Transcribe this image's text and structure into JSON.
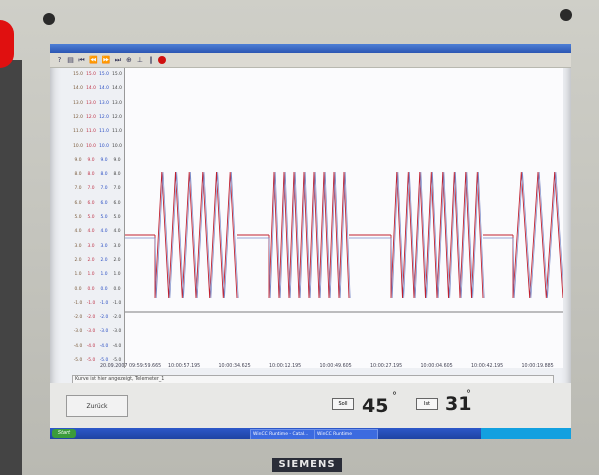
{
  "scales": {
    "columns": [
      {
        "color": "#7a5a3a",
        "values": [
          "15.0",
          "14.0",
          "13.0",
          "12.0",
          "11.0",
          "10.0",
          "9.0",
          "8.0",
          "7.0",
          "6.0",
          "5.0",
          "4.0",
          "3.0",
          "2.0",
          "1.0",
          "0.0",
          "-1.0",
          "-2.0",
          "-3.0",
          "-4.0",
          "-5.0"
        ]
      },
      {
        "color": "#c0364a",
        "values": [
          "15.0",
          "14.0",
          "13.0",
          "12.0",
          "11.0",
          "10.0",
          "9.0",
          "8.0",
          "7.0",
          "6.0",
          "5.0",
          "4.0",
          "3.0",
          "2.0",
          "1.0",
          "0.0",
          "-1.0",
          "-2.0",
          "-3.0",
          "-4.0",
          "-5.0"
        ]
      },
      {
        "color": "#2b4fc4",
        "values": [
          "15.0",
          "14.0",
          "13.0",
          "12.0",
          "11.0",
          "10.0",
          "9.0",
          "8.0",
          "7.0",
          "6.0",
          "5.0",
          "4.0",
          "3.0",
          "2.0",
          "1.0",
          "0.0",
          "-1.0",
          "-2.0",
          "-3.0",
          "-4.0",
          "-5.0"
        ]
      },
      {
        "color": "#444444",
        "values": [
          "15.0",
          "14.0",
          "13.0",
          "12.0",
          "11.0",
          "10.0",
          "9.0",
          "8.0",
          "7.0",
          "6.0",
          "5.0",
          "4.0",
          "3.0",
          "2.0",
          "1.0",
          "0.0",
          "-1.0",
          "-2.0",
          "-3.0",
          "-4.0",
          "-5.0"
        ]
      }
    ]
  },
  "time_labels": [
    "20.09.2007 09:59:59.665",
    "10:00:57.195",
    "10:00:34.625",
    "10:00:12.195",
    "10:00:49.605",
    "10:00:27.195",
    "10:00:04.605",
    "10:00:42.195",
    "10:00:19.885"
  ],
  "caption": "Kurve ist hier angezeigt, Telemeter_1",
  "buttons": {
    "zurueck": "Zurück"
  },
  "indicators": [
    {
      "box": "Soll",
      "value": "45",
      "unit": "°"
    },
    {
      "box": "Ist",
      "value": "31",
      "unit": "°"
    }
  ],
  "taskbar": {
    "start": "Start",
    "items": [
      "WinCC Runtime - Catal...",
      "WinCC Runtime"
    ]
  },
  "brand": "SIEMENS",
  "colors": {
    "signal_red": "#c02030",
    "signal_blue": "#7a8ac8",
    "baseline": "#555555"
  }
}
